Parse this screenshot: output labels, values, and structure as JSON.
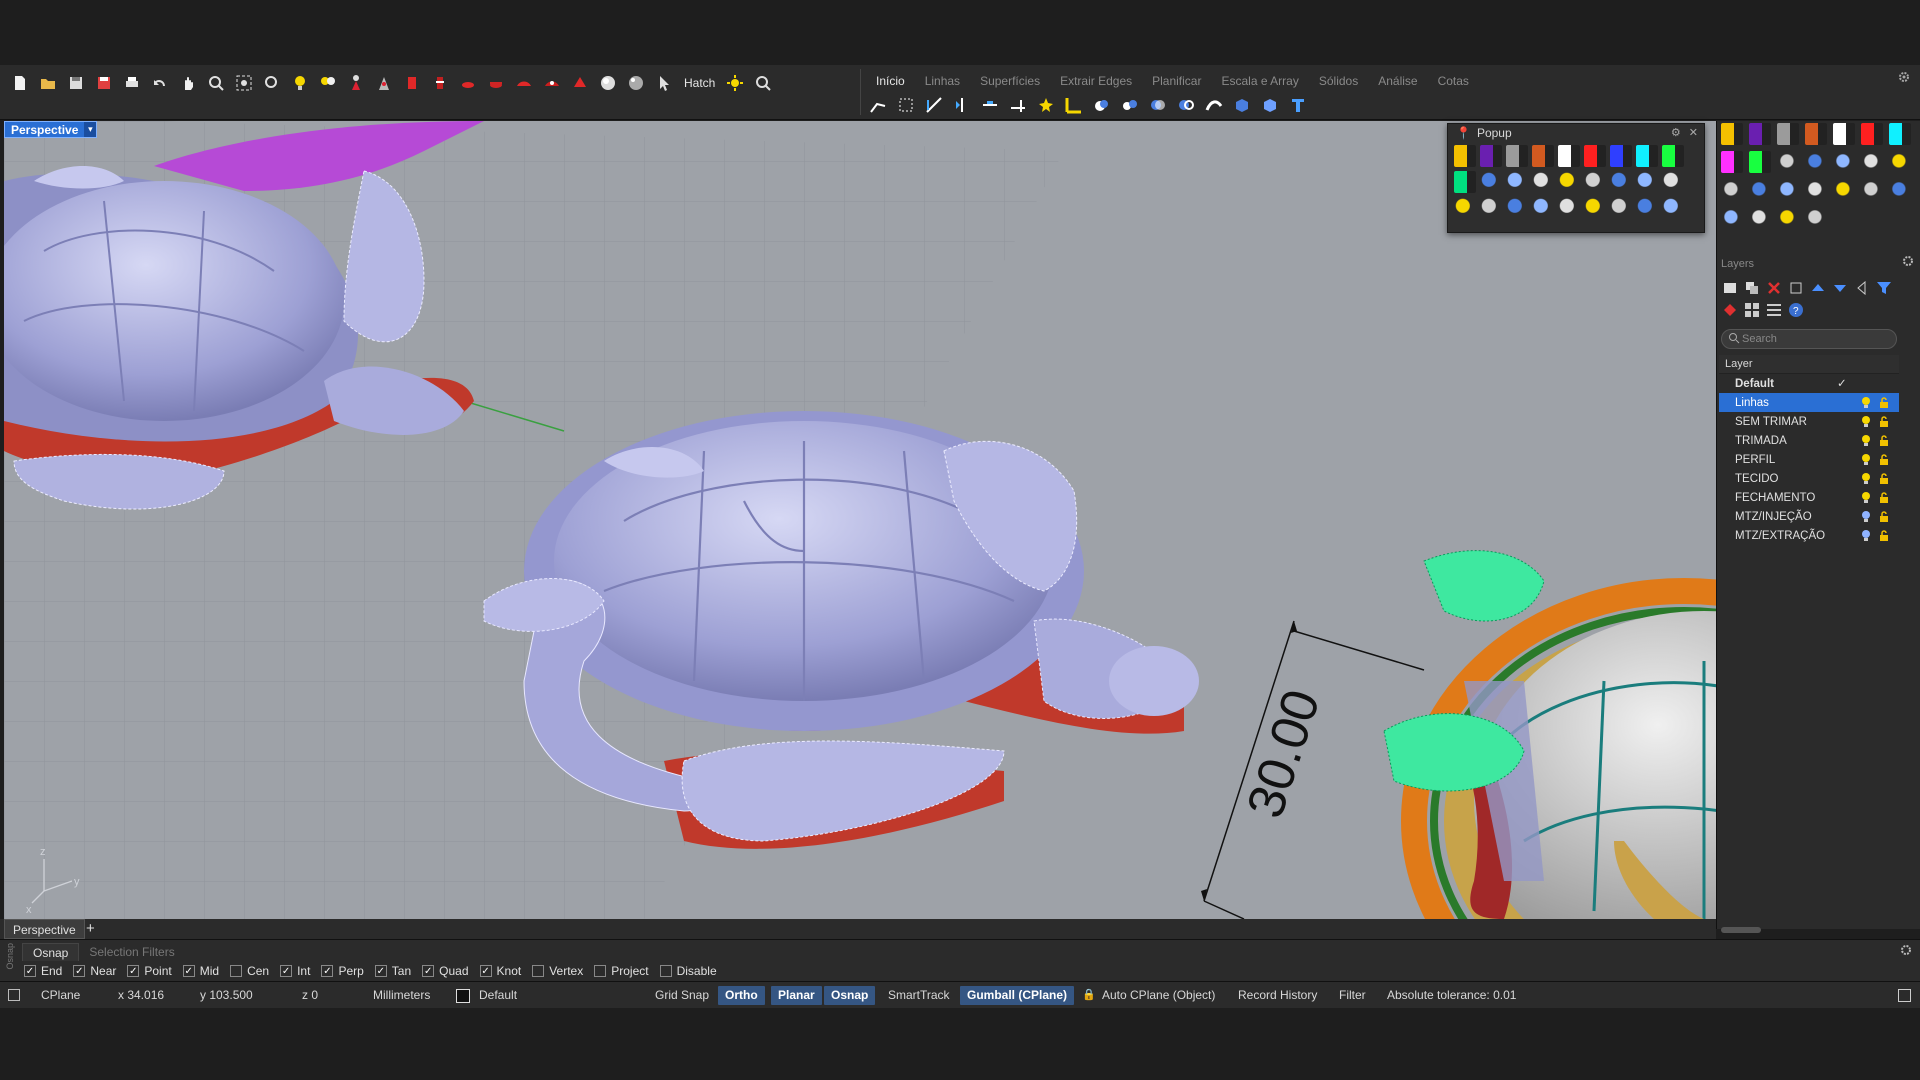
{
  "toolbar": {
    "hatch_label": "Hatch",
    "tabs": [
      "Início",
      "Linhas",
      "Superfícies",
      "Extrair Edges",
      "Planificar",
      "Escala e Array",
      "Sólidos",
      "Análise",
      "Cotas"
    ],
    "active_tab": "Início"
  },
  "viewport": {
    "title": "Perspective",
    "dimension_value": "30.00",
    "axis_labels": {
      "z": "z",
      "y": "y",
      "x": "x"
    }
  },
  "popup": {
    "title": "Popup",
    "swatch_colors": [
      "#f4c000",
      "#6a1fb0",
      "#9b9b9b",
      "#d25a20",
      "#ffffff",
      "#ff2020",
      "#2f3fff",
      "#10f0ff",
      "#18ff40",
      "#00e080"
    ]
  },
  "layers": {
    "header": "Layers",
    "search_placeholder": "Search",
    "column_layer": "Layer",
    "items": [
      {
        "name": "Default",
        "current": true,
        "selected": false
      },
      {
        "name": "Linhas",
        "current": false,
        "selected": true
      },
      {
        "name": "SEM TRIMAR",
        "current": false,
        "selected": false
      },
      {
        "name": "TRIMADA",
        "current": false,
        "selected": false
      },
      {
        "name": "PERFIL",
        "current": false,
        "selected": false
      },
      {
        "name": "TECIDO",
        "current": false,
        "selected": false
      },
      {
        "name": "FECHAMENTO",
        "current": false,
        "selected": false
      },
      {
        "name": "MTZ/INJEÇÃO",
        "current": false,
        "selected": false
      },
      {
        "name": "MTZ/EXTRAÇÃO",
        "current": false,
        "selected": false
      }
    ]
  },
  "viewport_tabs": {
    "tab": "Perspective",
    "add": "+"
  },
  "osnap": {
    "side_label": "Osnap",
    "tabs": [
      "Osnap",
      "Selection Filters"
    ],
    "items": [
      {
        "label": "End",
        "checked": true
      },
      {
        "label": "Near",
        "checked": true
      },
      {
        "label": "Point",
        "checked": true
      },
      {
        "label": "Mid",
        "checked": true
      },
      {
        "label": "Cen",
        "checked": false
      },
      {
        "label": "Int",
        "checked": true
      },
      {
        "label": "Perp",
        "checked": true
      },
      {
        "label": "Tan",
        "checked": true
      },
      {
        "label": "Quad",
        "checked": true
      },
      {
        "label": "Knot",
        "checked": true
      },
      {
        "label": "Vertex",
        "checked": false
      },
      {
        "label": "Project",
        "checked": false
      },
      {
        "label": "Disable",
        "checked": false
      }
    ]
  },
  "status": {
    "cplane": "CPlane",
    "x": "x 34.016",
    "y": "y 103.500",
    "z": "z 0",
    "units": "Millimeters",
    "layer": "Default",
    "grid_snap": "Grid Snap",
    "ortho": "Ortho",
    "planar": "Planar",
    "osnap": "Osnap",
    "smarttrack": "SmartTrack",
    "gumball": "Gumball (CPlane)",
    "auto_cplane": "Auto CPlane (Object)",
    "record_history": "Record History",
    "filter": "Filter",
    "tolerance": "Absolute tolerance: 0.01"
  },
  "colors": {
    "accent": "#2a6fd4",
    "viewport_bg": "#9ea2a8",
    "turtle_body": "#a9abdc",
    "turtle_base": "#c0392b",
    "green_flippers": "#3ee8a0",
    "orange_ring": "#e07a18"
  }
}
